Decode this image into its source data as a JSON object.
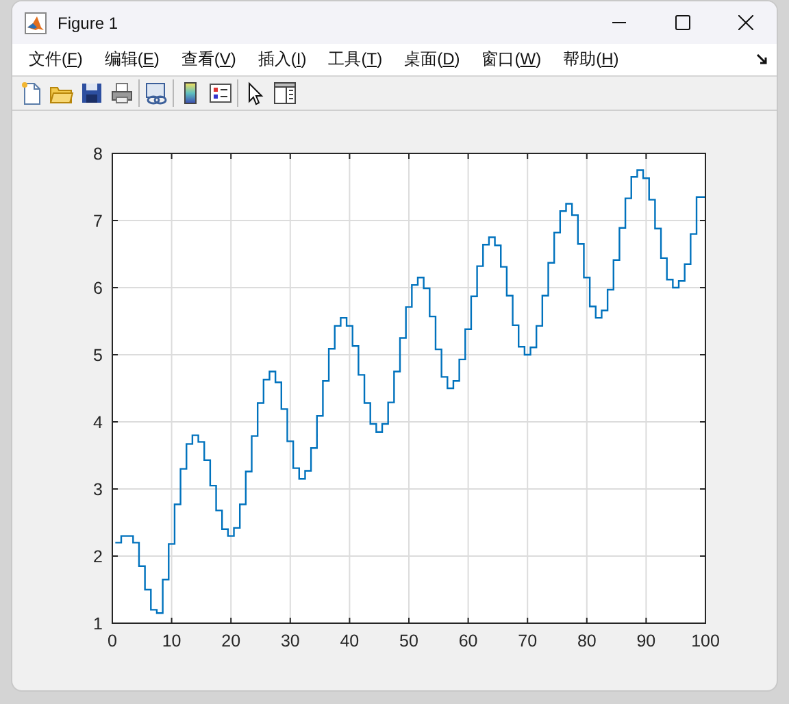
{
  "window": {
    "title": "Figure 1"
  },
  "menu": [
    {
      "label": "文件(F)"
    },
    {
      "label": "编辑(E)"
    },
    {
      "label": "查看(V)"
    },
    {
      "label": "插入(I)"
    },
    {
      "label": "工具(T)"
    },
    {
      "label": "桌面(D)"
    },
    {
      "label": "窗口(W)"
    },
    {
      "label": "帮助(H)"
    }
  ],
  "toolbar": {
    "groups": [
      {
        "tools": [
          {
            "kind": "new"
          },
          {
            "kind": "open"
          },
          {
            "kind": "save"
          },
          {
            "kind": "print"
          }
        ]
      },
      {
        "tools": [
          {
            "kind": "link"
          }
        ]
      },
      {
        "tools": [
          {
            "kind": "colorbar"
          },
          {
            "kind": "legend"
          }
        ]
      },
      {
        "tools": [
          {
            "kind": "pointer"
          },
          {
            "kind": "inspector"
          }
        ]
      }
    ]
  },
  "axes": {
    "chart_data": {
      "type": "line",
      "grid": true,
      "xlim": [
        0,
        100
      ],
      "ylim": [
        1,
        8
      ],
      "xticks": [
        0,
        10,
        20,
        30,
        40,
        50,
        60,
        70,
        80,
        90,
        100
      ],
      "yticks": [
        1,
        2,
        3,
        4,
        5,
        6,
        7,
        8
      ],
      "x": [
        1,
        2,
        3,
        4,
        5,
        6,
        7,
        8,
        9,
        10,
        11,
        12,
        13,
        14,
        15,
        16,
        17,
        18,
        19,
        20,
        21,
        22,
        23,
        24,
        25,
        26,
        27,
        28,
        29,
        30,
        31,
        32,
        33,
        34,
        35,
        36,
        37,
        38,
        39,
        40,
        41,
        42,
        43,
        44,
        45,
        46,
        47,
        48,
        49,
        50,
        51,
        52,
        53,
        54,
        55,
        56,
        57,
        58,
        59,
        60,
        61,
        62,
        63,
        64,
        65,
        66,
        67,
        68,
        69,
        70,
        71,
        72,
        73,
        74,
        75,
        76,
        77,
        78,
        79,
        80,
        81,
        82,
        83,
        84,
        85,
        86,
        87,
        88,
        89,
        90,
        91,
        92,
        93,
        94,
        95,
        96,
        97,
        98,
        99,
        100
      ],
      "series": [
        {
          "color": "#0072bd",
          "values": [
            2.2,
            2.3,
            2.3,
            2.2,
            1.85,
            1.5,
            1.2,
            1.15,
            1.65,
            2.18,
            2.77,
            3.3,
            3.67,
            3.8,
            3.7,
            3.43,
            3.05,
            2.68,
            2.4,
            2.3,
            2.42,
            2.77,
            3.26,
            3.79,
            4.28,
            4.63,
            4.75,
            4.59,
            4.19,
            3.71,
            3.31,
            3.15,
            3.27,
            3.61,
            4.09,
            4.61,
            5.09,
            5.43,
            5.55,
            5.43,
            5.13,
            4.7,
            4.28,
            3.97,
            3.85,
            3.97,
            4.29,
            4.75,
            5.25,
            5.71,
            6.04,
            6.15,
            5.99,
            5.57,
            5.08,
            4.67,
            4.5,
            4.61,
            4.93,
            5.38,
            5.87,
            6.32,
            6.64,
            6.75,
            6.63,
            6.31,
            5.88,
            5.44,
            5.12,
            5.0,
            5.11,
            5.43,
            5.88,
            6.37,
            6.82,
            7.14,
            7.25,
            7.08,
            6.65,
            6.15,
            5.72,
            5.55,
            5.66,
            5.97,
            6.41,
            6.89,
            7.33,
            7.65,
            7.75,
            7.63,
            7.31,
            6.88,
            6.44,
            6.12,
            6.0,
            6.1,
            6.35,
            6.8,
            7.35,
            7.35
          ]
        }
      ]
    }
  }
}
